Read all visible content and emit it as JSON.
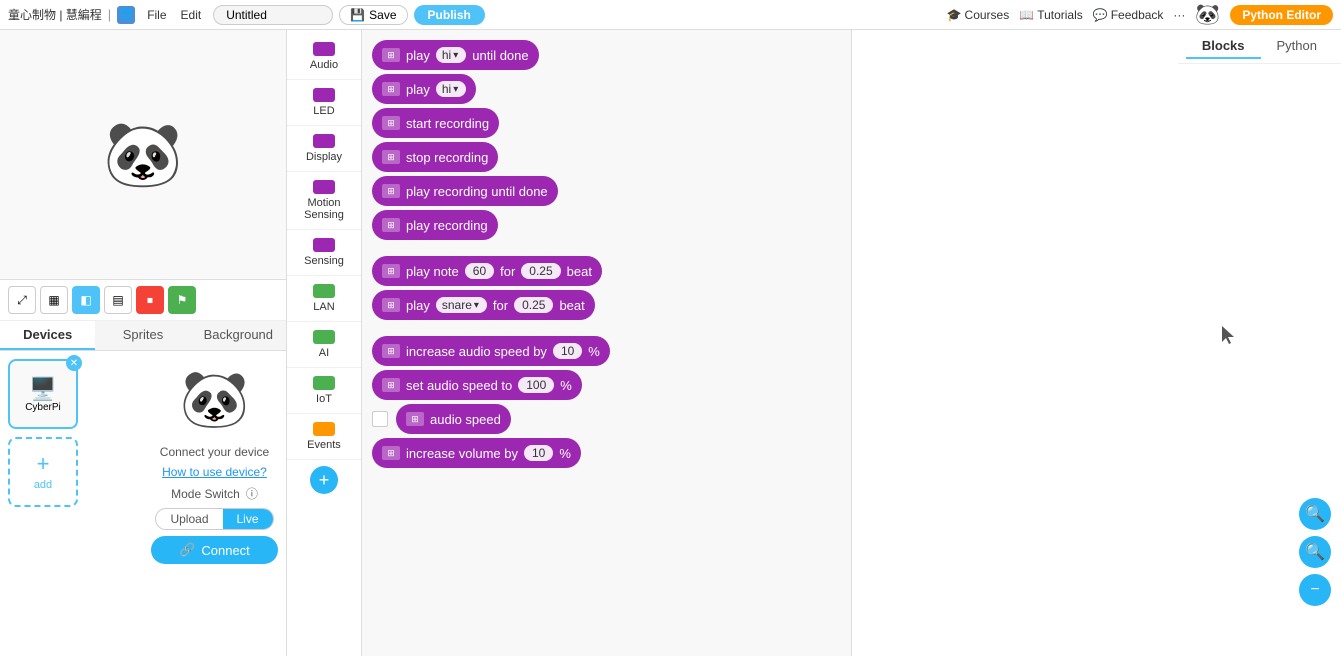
{
  "topbar": {
    "brand": "童心制物 | 慧編程",
    "menus": [
      "File",
      "Edit"
    ],
    "title_placeholder": "Untitled",
    "save_label": "Save",
    "publish_label": "Publish",
    "courses_label": "Courses",
    "tutorials_label": "Tutorials",
    "feedback_label": "Feedback",
    "more_label": "···",
    "python_editor_label": "Python Editor"
  },
  "left_panel": {
    "tabs": [
      "Devices",
      "Sprites",
      "Background"
    ],
    "active_tab": "Devices",
    "devices": [
      {
        "name": "CyberPi",
        "icon": "🖥️"
      }
    ],
    "add_label": "add",
    "sprite": {
      "connect_label": "Connect your device",
      "how_to": "How to use device?",
      "mode_switch": "Mode Switch",
      "upload_label": "Upload",
      "live_label": "Live",
      "connect_btn": "Connect"
    }
  },
  "categories": [
    {
      "key": "audio",
      "label": "Audio",
      "color": "#9c27b0"
    },
    {
      "key": "led",
      "label": "LED",
      "color": "#9c27b0"
    },
    {
      "key": "display",
      "label": "Display",
      "color": "#9c27b0"
    },
    {
      "key": "motion",
      "label": "Motion Sensing",
      "color": "#9c27b0"
    },
    {
      "key": "sensing",
      "label": "Sensing",
      "color": "#9c27b0"
    },
    {
      "key": "lan",
      "label": "LAN",
      "color": "#4caf50"
    },
    {
      "key": "ai",
      "label": "AI",
      "color": "#4caf50"
    },
    {
      "key": "iot",
      "label": "IoT",
      "color": "#4caf50"
    },
    {
      "key": "events",
      "label": "Events",
      "color": "#ff9800"
    }
  ],
  "blocks": [
    {
      "id": "play-hi-until-done",
      "type": "purple",
      "parts": [
        "play",
        "hi",
        "until done"
      ],
      "dropdown": "hi"
    },
    {
      "id": "play-hi",
      "type": "purple",
      "parts": [
        "play",
        "hi"
      ],
      "dropdown": "hi"
    },
    {
      "id": "start-recording",
      "type": "purple",
      "parts": [
        "start recording"
      ]
    },
    {
      "id": "stop-recording",
      "type": "purple",
      "parts": [
        "stop recording"
      ]
    },
    {
      "id": "play-recording-until-done",
      "type": "purple",
      "parts": [
        "play recording until done"
      ]
    },
    {
      "id": "play-recording",
      "type": "purple",
      "parts": [
        "play recording"
      ]
    },
    {
      "id": "play-note",
      "type": "purple",
      "parts": [
        "play note",
        "60",
        "for",
        "0.25",
        "beat"
      ],
      "inputs": [
        "60",
        "0.25"
      ]
    },
    {
      "id": "play-snare",
      "type": "purple",
      "parts": [
        "play",
        "snare",
        "for",
        "0.25",
        "beat"
      ],
      "dropdown": "snare"
    },
    {
      "id": "increase-audio-speed",
      "type": "purple",
      "parts": [
        "increase audio speed by",
        "10",
        "%"
      ],
      "inputs": [
        "10"
      ]
    },
    {
      "id": "set-audio-speed",
      "type": "purple",
      "parts": [
        "set audio speed to",
        "100",
        "%"
      ],
      "inputs": [
        "100"
      ]
    },
    {
      "id": "audio-speed",
      "type": "purple",
      "parts": [
        "audio speed"
      ],
      "checkbox": true
    },
    {
      "id": "increase-volume",
      "type": "purple",
      "parts": [
        "increase volume by",
        "10",
        "%"
      ],
      "inputs": [
        "10"
      ]
    }
  ],
  "view_tabs": {
    "blocks_label": "Blocks",
    "python_label": "Python",
    "active": "Blocks"
  },
  "zoom_controls": {
    "zoom_in": "+",
    "zoom_out": "-",
    "reset": "⊙"
  }
}
